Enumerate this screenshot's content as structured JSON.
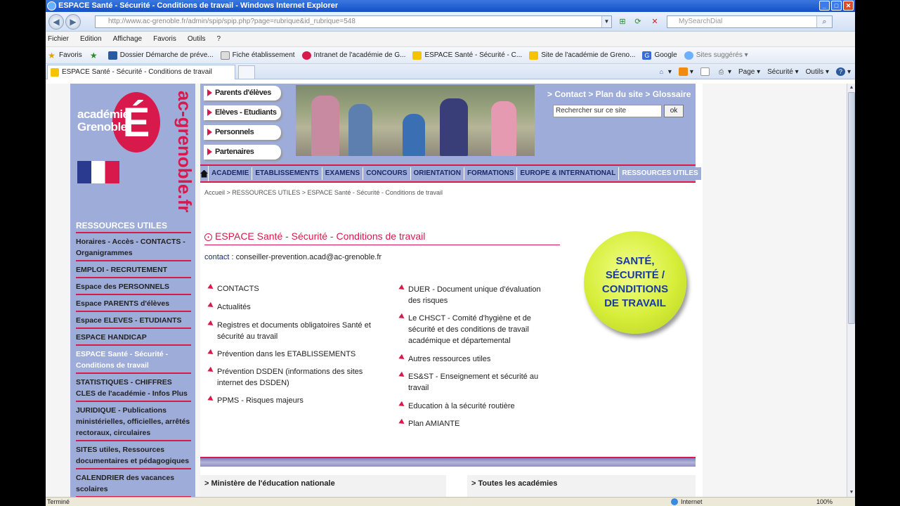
{
  "window": {
    "title": "ESPACE Santé - Sécurité - Conditions de travail - Windows Internet Explorer"
  },
  "browser": {
    "address": "http://www.ac-grenoble.fr/admin/spip/spip.php?page=rubrique&id_rubrique=548",
    "search_placeholder": "MySearchDial",
    "menu": [
      "Fichier",
      "Edition",
      "Affichage",
      "Favoris",
      "Outils",
      "?"
    ],
    "favorites_label": "Favoris",
    "favorites": [
      "Dossier Démarche de préve...",
      "Fiche établissement",
      "Intranet de l'académie de G...",
      "ESPACE Santé - Sécurité - C...",
      "Site de l'académie de Greno...",
      "Google",
      "Sites suggérés ▾"
    ],
    "tab_title": "ESPACE Santé - Sécurité - Conditions de travail",
    "command_bar": [
      "Page ▾",
      "Sécurité ▾",
      "Outils ▾"
    ],
    "status": "Terminé",
    "zone": "Internet",
    "zoom": "100%"
  },
  "site": {
    "logo_text_1": "académie",
    "logo_text_2": "Grenoble",
    "logo_letter": "É",
    "domain": "ac-grenoble.fr",
    "audiences": [
      "Parents d'élèves",
      "Elèves - Etudiants",
      "Personnels",
      "Partenaires"
    ],
    "header_links": "> Contact > Plan du site > Glossaire",
    "search_value": "Rechercher sur ce site",
    "ok_label": "ok",
    "topnav": [
      "ACADEMIE",
      "ETABLISSEMENTS",
      "EXAMENS",
      "CONCOURS",
      "ORIENTATION",
      "FORMATIONS",
      "EUROPE & INTERNATIONAL",
      "RESSOURCES UTILES"
    ],
    "breadcrumb": "Accueil > RESSOURCES UTILES > ESPACE Santé - Sécurité - Conditions de travail",
    "sidebar": {
      "header": "RESSOURCES UTILES",
      "items": [
        "Horaires - Accès - CONTACTS - Organigrammes",
        "EMPLOI - RECRUTEMENT",
        "Espace des PERSONNELS",
        "Espace PARENTS d'élèves",
        "Espace ELEVES - ETUDIANTS",
        "ESPACE HANDICAP",
        "ESPACE Santé - Sécurité - Conditions de travail",
        "STATISTIQUES - CHIFFRES CLES de l'académie - Infos Plus",
        "JURIDIQUE - Publications ministérielles, officielles, arrêtés rectoraux, circulaires",
        "SITES utiles, Ressources documentaires et pédagogiques",
        "CALENDRIER des vacances scolaires"
      ]
    },
    "page_title": "ESPACE Santé - Sécurité - Conditions de travail",
    "contact_label": "contact",
    "contact_value": ": conseiller-prevention.acad@ac-grenoble.fr",
    "links_left": [
      "CONTACTS",
      "Actualités",
      "Registres et documents obligatoires Santé et sécurité au travail",
      "Prévention dans les ETABLISSEMENTS",
      "Prévention DSDEN (informations des sites internet des DSDEN)",
      "PPMS - Risques majeurs"
    ],
    "links_right": [
      "DUER - Document unique d'évaluation des risques",
      "Le CHSCT - Comité d'hygiène et de sécurité et des conditions de travail académique et départemental",
      "Autres ressources utiles",
      "ES&ST - Enseignement et sécurité au travail",
      "Education à la sécurité routière",
      "Plan AMIANTE"
    ],
    "badge": [
      "SANTÉ,",
      "SÉCURITÉ /",
      "CONDITIONS",
      "DE TRAVAIL"
    ],
    "bottom_left": "> Ministère de l'éducation nationale",
    "bottom_right": "> Toutes les académies"
  },
  "colors": {
    "accent": "#d8194c",
    "sidebar_bg": "#9dacd9",
    "badge": "#d6ee3a"
  }
}
